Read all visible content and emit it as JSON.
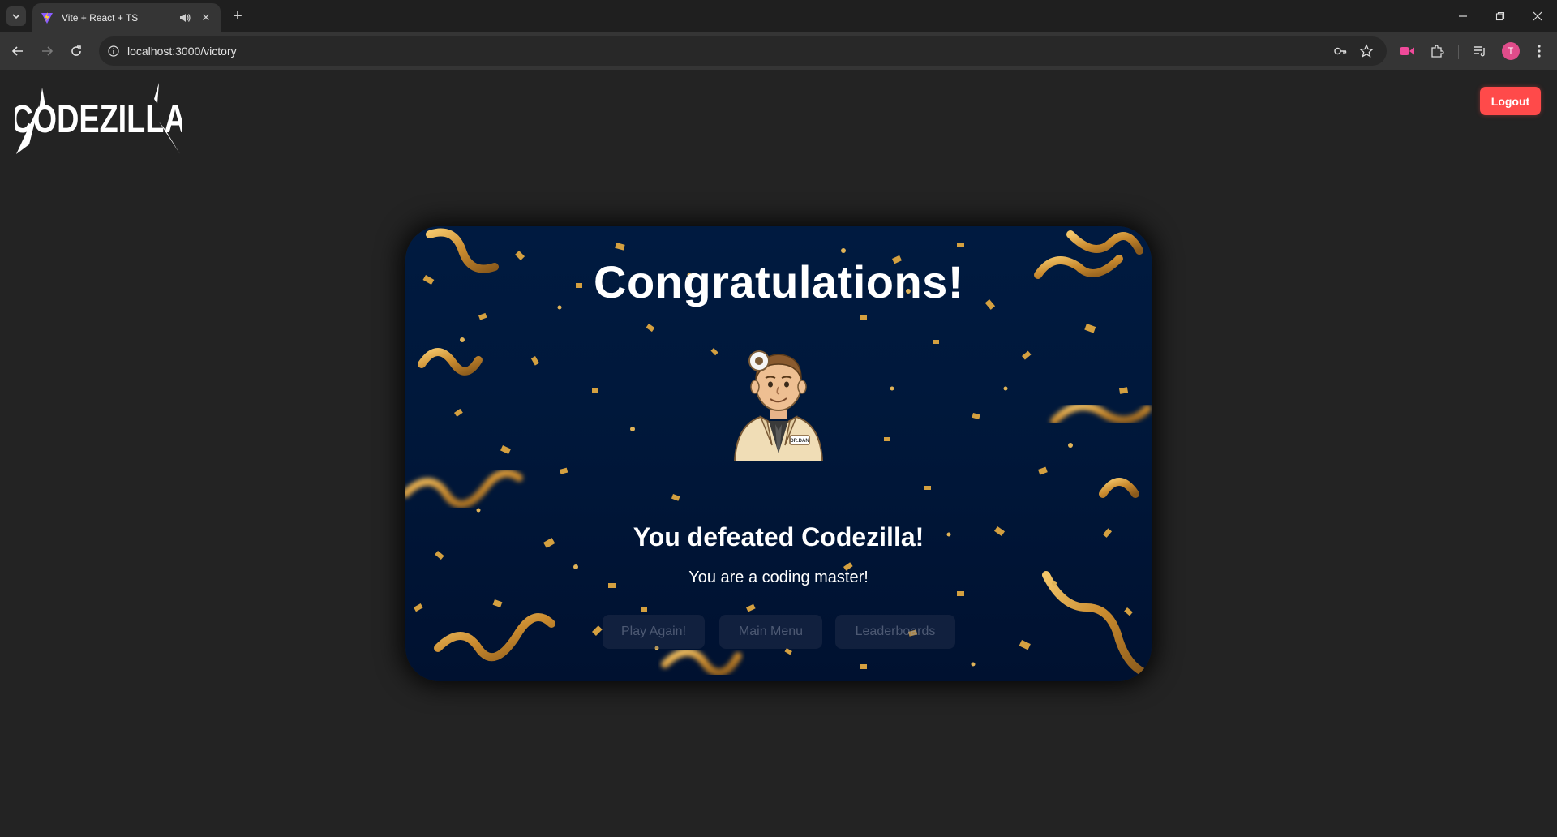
{
  "browser": {
    "tab_title": "Vite + React + TS",
    "url": "localhost:3000/victory",
    "profile_initial": "T"
  },
  "app": {
    "logo_text": "CODEZILLA",
    "logout_label": "Logout"
  },
  "victory": {
    "title": "Congratulations!",
    "heading": "You defeated Codezilla!",
    "subtitle": "You are a coding master!",
    "badge_text": "DR.DAN",
    "buttons": {
      "play_again": "Play Again!",
      "main_menu": "Main Menu",
      "leaderboards": "Leaderboards"
    }
  },
  "colors": {
    "logout": "#ff4a4a",
    "card_bg": "#001a40",
    "confetti_gold": "#d4a040"
  }
}
